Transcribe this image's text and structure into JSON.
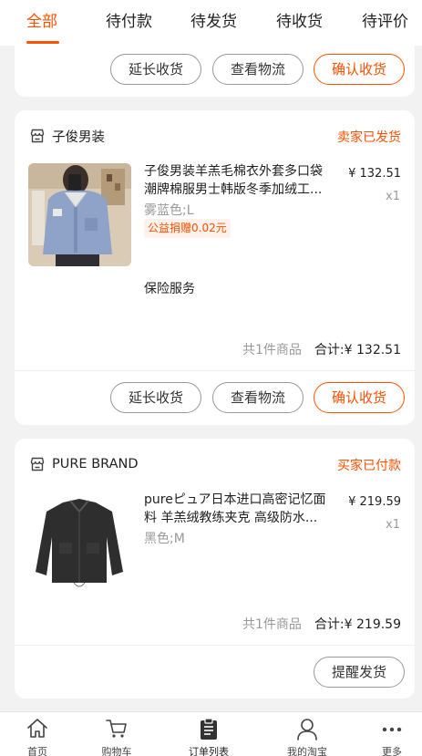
{
  "tabs": [
    {
      "label": "全部",
      "active": true
    },
    {
      "label": "待付款"
    },
    {
      "label": "待发货"
    },
    {
      "label": "待收货"
    },
    {
      "label": "待评价"
    }
  ],
  "colors": {
    "accent": "#ff5000",
    "muted": "#999999",
    "promo_bg": "#fff1eb"
  },
  "top_card": {
    "buttons": {
      "extend": "延长收货",
      "logistics": "查看物流",
      "confirm": "确认收货"
    }
  },
  "order1": {
    "shop_icon": "store-icon",
    "shop_name": "子俊男装",
    "status": "卖家已发货",
    "title_line1": "子俊男装羊羔毛棉衣外套多口袋",
    "title_line2": "潮牌棉服男士韩版冬季加绒工...",
    "sku": "雾蓝色;L",
    "promo": "公益捐赠0.02元",
    "price": "¥ 132.51",
    "qty": "x1",
    "insurance": "保险服务",
    "item_count": "共1件商品",
    "total_label": "合计:",
    "total_value": "¥ 132.51",
    "buttons": {
      "extend": "延长收货",
      "logistics": "查看物流",
      "confirm": "确认收货"
    }
  },
  "order2": {
    "shop_icon": "store-icon",
    "shop_name": "PURE BRAND",
    "status": "买家已付款",
    "title_line1": "pureピュア日本进口高密记忆面",
    "title_line2": "料 羊羔绒教练夹克 高级防水...",
    "sku": "黑色;M",
    "price": "¥ 219.59",
    "qty": "x1",
    "item_count": "共1件商品",
    "total_label": "合计:",
    "total_value": "¥ 219.59",
    "buttons": {
      "remind": "提醒发货"
    }
  },
  "bottom_nav": [
    {
      "label": "首页",
      "icon": "home-icon"
    },
    {
      "label": "购物车",
      "icon": "cart-icon"
    },
    {
      "label": "订单列表",
      "icon": "clipboard-icon",
      "active": true
    },
    {
      "label": "我的淘宝",
      "icon": "user-icon"
    },
    {
      "label": "更多",
      "icon": "more-icon"
    }
  ]
}
